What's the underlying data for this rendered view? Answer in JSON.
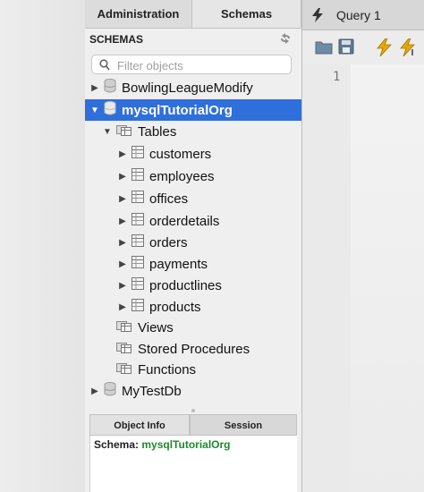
{
  "sidebar": {
    "tabs": {
      "administration": "Administration",
      "schemas": "Schemas"
    },
    "header": "SCHEMAS",
    "search_placeholder": "Filter objects",
    "tree": [
      {
        "label": "BowlingLeagueModify"
      },
      {
        "label": "mysqlTutorialOrg"
      },
      {
        "label": "Tables"
      },
      {
        "label": "customers"
      },
      {
        "label": "employees"
      },
      {
        "label": "offices"
      },
      {
        "label": "orderdetails"
      },
      {
        "label": "orders"
      },
      {
        "label": "payments"
      },
      {
        "label": "productlines"
      },
      {
        "label": "products"
      },
      {
        "label": "Views"
      },
      {
        "label": "Stored Procedures"
      },
      {
        "label": "Functions"
      },
      {
        "label": "MyTestDb"
      }
    ],
    "bottom_tabs": {
      "object_info": "Object Info",
      "session": "Session"
    },
    "info": {
      "key": "Schema:",
      "value": "mysqlTutorialOrg"
    }
  },
  "editor": {
    "tab_label": "Query 1",
    "line_numbers": [
      "1"
    ]
  },
  "colors": {
    "selection": "#2f6fdb",
    "schema_value": "#1a8c2a",
    "bolt": "#e6a800"
  },
  "icons": {
    "schema": "database-icon",
    "tables": "table-folder-icon",
    "table": "table-icon",
    "refresh": "refresh-icon",
    "search": "search-icon",
    "open": "folder-open-icon",
    "save": "save-icon",
    "execute": "lightning-icon",
    "execute_selection": "lightning-cursor-icon"
  }
}
